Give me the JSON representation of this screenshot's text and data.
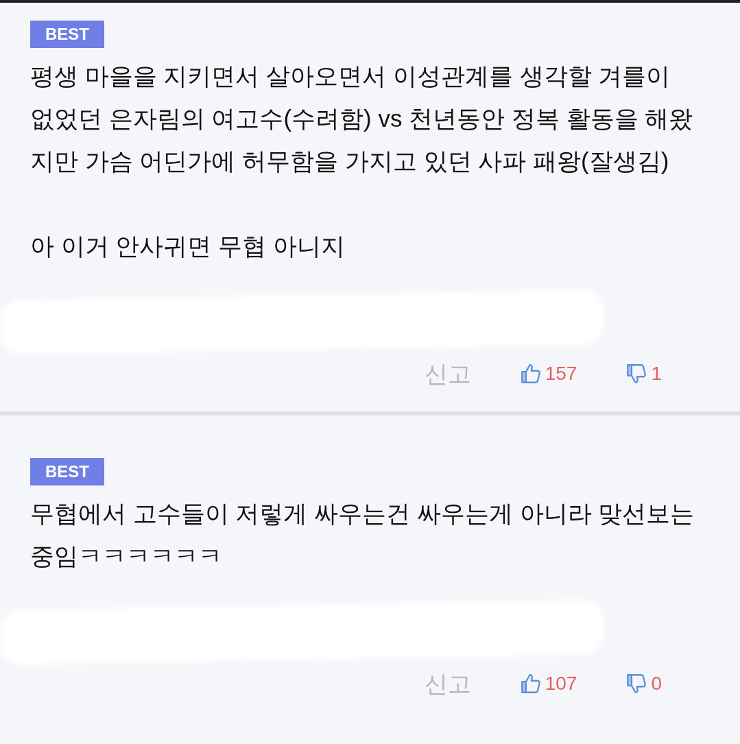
{
  "comments": [
    {
      "badge": "BEST",
      "paragraphs": [
        "평생 마을을 지키면서 살아오면서 이성관계를 생각할 겨를이 없었던 은자림의 여고수(수려함) vs 천년동안 정복 활동을 해왔지만 가슴 어딘가에 허무함을 가지고 있던 사파 패왕(잘생김)",
        "아 이거 안사귀면 무협 아니지"
      ],
      "report": "신고",
      "likes": "157",
      "dislikes": "1"
    },
    {
      "badge": "BEST",
      "paragraphs": [
        "무협에서 고수들이 저렇게 싸우는건 싸우는게 아니라 맞선보는중임ㅋㅋㅋㅋㅋㅋ"
      ],
      "report": "신고",
      "likes": "107",
      "dislikes": "0"
    }
  ]
}
